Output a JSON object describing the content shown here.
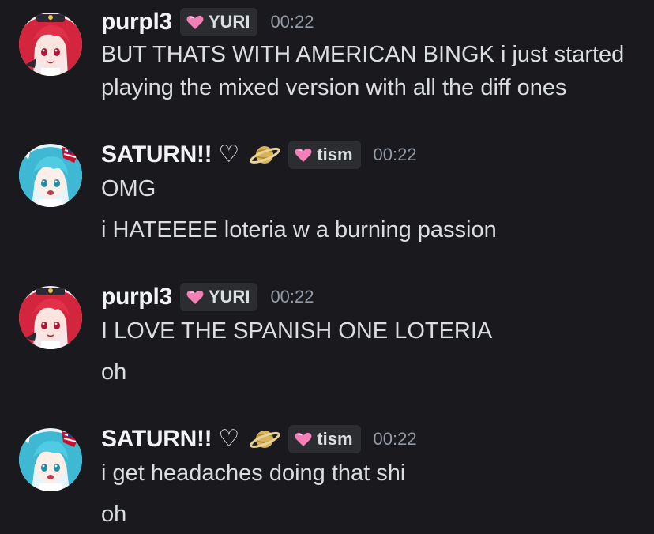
{
  "groups": [
    {
      "username": "purpl3",
      "heart": "",
      "has_saturn": false,
      "tag": "YURI",
      "timestamp": "00:22",
      "lines": [
        "BUT THATS WITH AMERICAN BINGK i just started",
        "playing the mixed version with all the diff ones"
      ],
      "avatar_icon": "red-haired-anime-avatar"
    },
    {
      "username": "SATURN!!",
      "heart": "♡",
      "has_saturn": true,
      "tag": "tism",
      "timestamp": "00:22",
      "lines": [
        "OMG",
        "i HATEEEE loteria w a burning passion"
      ],
      "avatar_icon": "blue-haired-anime-avatar"
    },
    {
      "username": "purpl3",
      "heart": "",
      "has_saturn": false,
      "tag": "YURI",
      "timestamp": "00:22",
      "lines": [
        "I LOVE THE SPANISH ONE LOTERIA",
        "oh"
      ],
      "avatar_icon": "red-haired-anime-avatar"
    },
    {
      "username": "SATURN!!",
      "heart": "♡",
      "has_saturn": true,
      "tag": "tism",
      "timestamp": "00:22",
      "lines": [
        "i get headaches doing that shi",
        "oh"
      ],
      "avatar_icon": "blue-haired-anime-avatar"
    }
  ],
  "colors": {
    "background": "#1a1a1e",
    "username": "#f2f3f5",
    "text": "#dbdee1",
    "timestamp": "#949ba4",
    "badge_bg": "#2b2d31",
    "badge_heart": "#f47fb6"
  }
}
